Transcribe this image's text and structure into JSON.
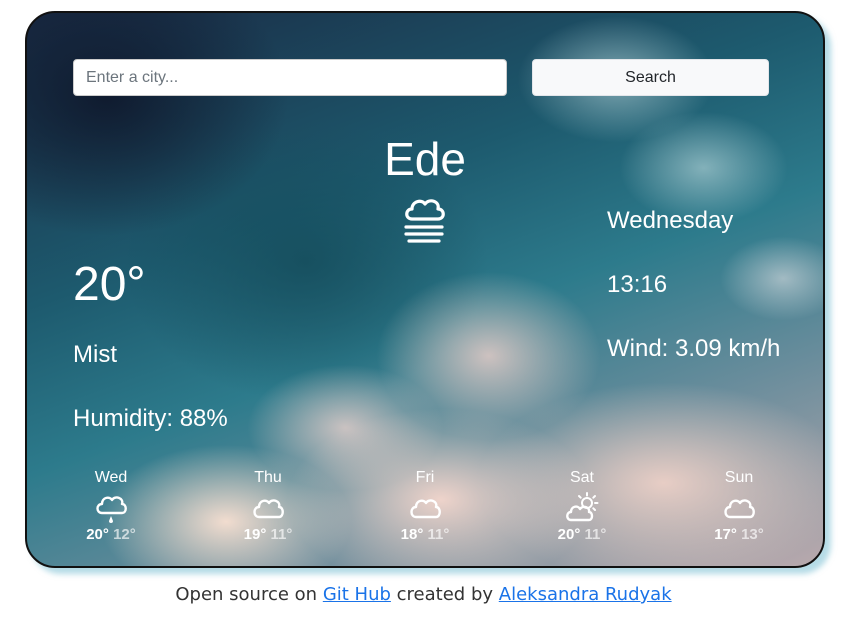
{
  "search": {
    "placeholder": "Enter a city...",
    "value": "",
    "button_label": "Search"
  },
  "current": {
    "city": "Ede",
    "icon": "mist-icon",
    "temperature": "20°",
    "description": "Mist",
    "humidity": "Humidity: 88%",
    "day": "Wednesday",
    "time": "13:16",
    "wind": "Wind: 3.09 km/h"
  },
  "forecast": [
    {
      "day": "Wed",
      "icon": "rain-cloud-icon",
      "max": "20°",
      "min": "12°"
    },
    {
      "day": "Thu",
      "icon": "cloud-icon",
      "max": "19°",
      "min": "11°"
    },
    {
      "day": "Fri",
      "icon": "cloud-icon",
      "max": "18°",
      "min": "11°"
    },
    {
      "day": "Sat",
      "icon": "partly-sunny-icon",
      "max": "20°",
      "min": "11°"
    },
    {
      "day": "Sun",
      "icon": "cloud-icon",
      "max": "17°",
      "min": "13°"
    }
  ],
  "footer": {
    "prefix": "Open source on",
    "github_link": "Git Hub",
    "middle": "created by",
    "author_link": "Aleksandra Rudyak"
  },
  "colors": {
    "text": "#ffffff",
    "link": "#1a73e8",
    "card_border": "#111111",
    "card_shadow": "#78bed2"
  }
}
